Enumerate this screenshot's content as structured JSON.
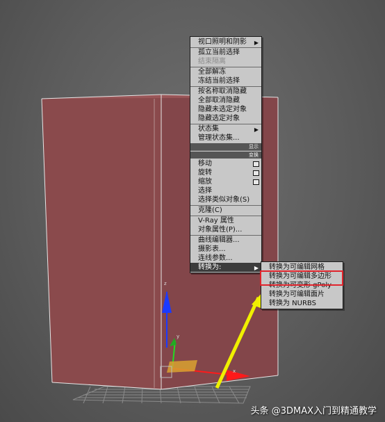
{
  "context_menu": {
    "items": [
      {
        "label": "视口照明和阴影",
        "submenu": true
      },
      {
        "label": "孤立当前选择"
      },
      {
        "label": "结束隔离",
        "disabled": true
      },
      {
        "label": "全部解冻"
      },
      {
        "label": "冻结当前选择"
      },
      {
        "label": "按名称取消隐藏"
      },
      {
        "label": "全部取消隐藏"
      },
      {
        "label": "隐藏未选定对象"
      },
      {
        "label": "隐藏选定对象"
      },
      {
        "label": "状态集",
        "submenu": true
      },
      {
        "label": "管理状态集..."
      },
      {
        "label": "移动",
        "box": true
      },
      {
        "label": "旋转",
        "box": true
      },
      {
        "label": "缩放",
        "box": true
      },
      {
        "label": "选择"
      },
      {
        "label": "选择类似对象(S)"
      },
      {
        "label": "克隆(C)"
      },
      {
        "label": "V-Ray 属性"
      },
      {
        "label": "对象属性(P)..."
      },
      {
        "label": "曲线编辑器..."
      },
      {
        "label": "摄影表..."
      },
      {
        "label": "连线参数..."
      },
      {
        "label": "转换为:",
        "submenu": true,
        "selected": true
      }
    ],
    "header_display": "显示",
    "header_transform": "变换"
  },
  "submenu": {
    "items": [
      {
        "label": "转换为可编辑网格"
      },
      {
        "label": "转换为可编辑多边形",
        "highlighted": true
      },
      {
        "label": "转换为可变形 gPoly"
      },
      {
        "label": "转换为可编辑面片"
      },
      {
        "label": "转换为 NURBS"
      }
    ]
  },
  "gizmo": {
    "x_label": "x",
    "y_label": "y",
    "z_label": "z"
  },
  "watermark": "头条 @3DMAX入门到精通教学",
  "colors": {
    "object": "#8a4a4c",
    "menu_bg": "#c8c8c8",
    "highlight": "#e0242c",
    "arrow": "#f0f000"
  }
}
